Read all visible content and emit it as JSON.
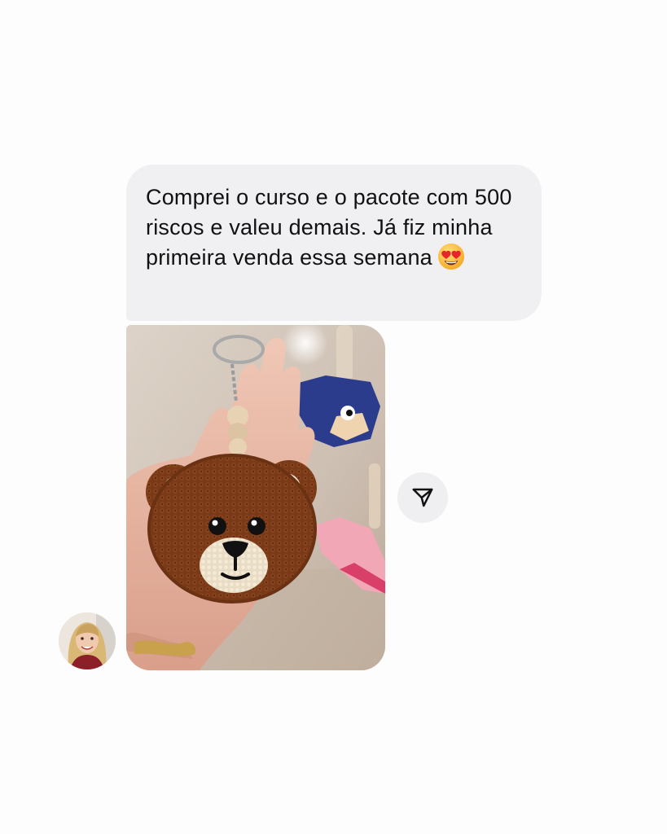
{
  "conversation": {
    "message": {
      "text": "Comprei o curso e o pacote com 500 riscos e valeu demais. Já fiz minha primeira venda essa semana",
      "emoji": "smiling-face-with-heart-eyes"
    },
    "photo": {
      "subject": "punch-needle-bear-keychain-photo"
    },
    "share_button": {
      "icon": "paper-plane-icon"
    },
    "sender_avatar": {
      "icon": "profile-photo"
    },
    "colors": {
      "bubble": "#f0f0f2",
      "text": "#111111",
      "background": "#fdfdfd"
    }
  }
}
